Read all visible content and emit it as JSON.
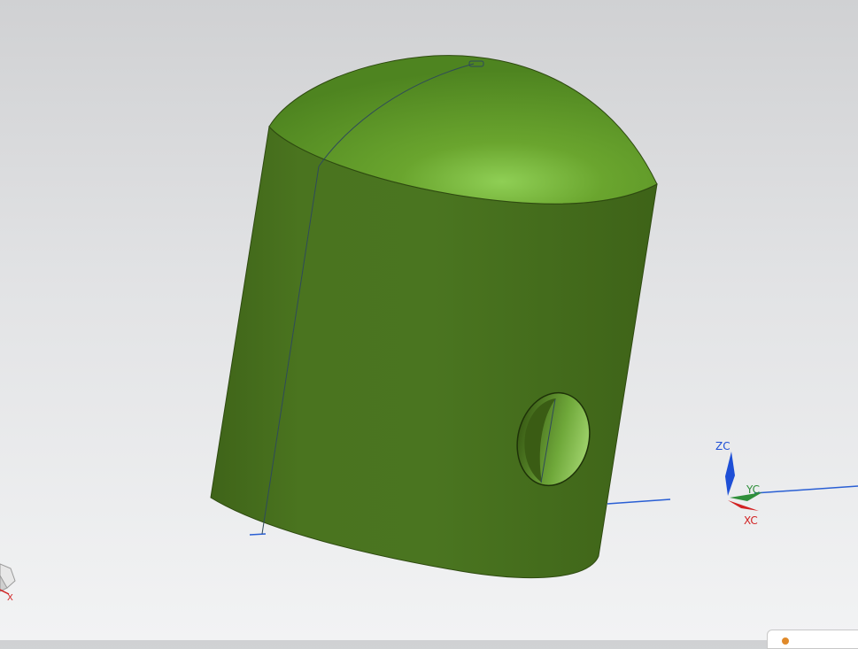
{
  "viewport": {
    "model": "cylinder-with-dome-cap",
    "model_color": "#4f7a1f",
    "dome_highlight_color": "#8fcf55",
    "background_top": "#d0d1d3",
    "background_bottom": "#f2f3f4"
  },
  "triad": {
    "z_label": "ZC",
    "y_label": "YC",
    "x_label": "XC",
    "z_color": "#1e4fd6",
    "y_color": "#2f8f3a",
    "x_color": "#d22222"
  },
  "view_cube": {
    "x_label": "X"
  }
}
